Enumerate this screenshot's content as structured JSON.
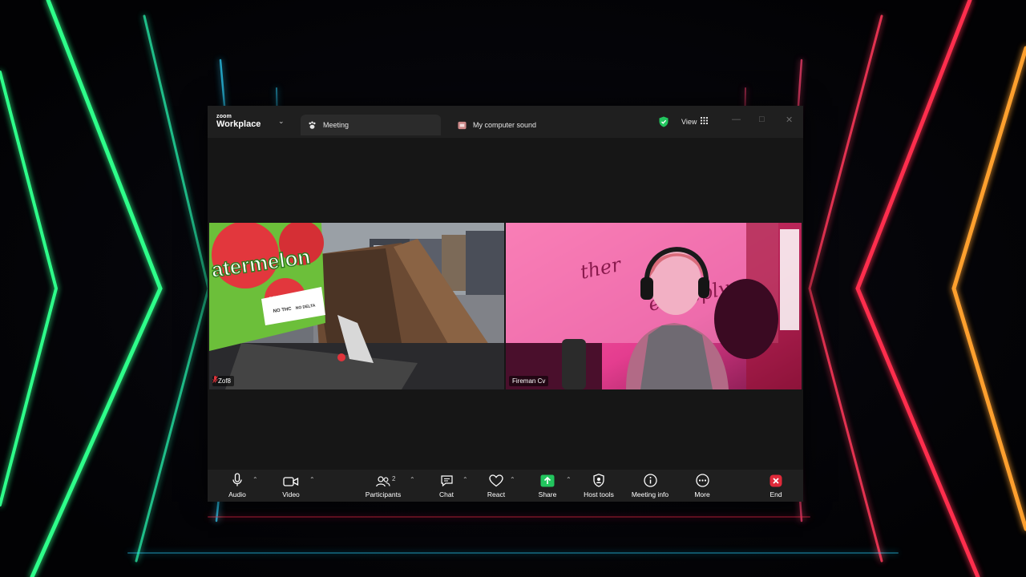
{
  "colors": {
    "neon_green": "#2dff8a",
    "neon_red": "#ff2d4d",
    "neon_orange": "#ffa02d",
    "neon_teal": "#2dd4ff",
    "zoom_dark": "#1a1a1a",
    "share_green": "#22c55e",
    "end_red": "#e02a3a"
  },
  "app": {
    "brand_small": "zoom",
    "brand_big": "Workplace"
  },
  "tabs": [
    {
      "label": "Meeting",
      "icon": "meeting-paw-icon",
      "active": true
    },
    {
      "label": "My computer sound",
      "icon": "speaker-app-icon",
      "active": false
    }
  ],
  "header": {
    "view_label": "View",
    "security_icon": "shield-check-icon"
  },
  "participants": [
    {
      "name": "Zof8",
      "muted": true
    },
    {
      "name": "Fireman Cv",
      "muted": false
    }
  ],
  "video_1": {
    "sign_text": "atermelon",
    "sub_text": "3 GUMMIES PER BAG",
    "tag1": "NO THC",
    "tag2": "NO DELTA"
  },
  "video_2": {
    "banner_text_1": "ther",
    "banner_text_2": "e deeply"
  },
  "toolbar": {
    "audio": "Audio",
    "video": "Video",
    "participants": "Participants",
    "participant_count": "2",
    "chat": "Chat",
    "react": "React",
    "share": "Share",
    "host_tools": "Host tools",
    "meeting_info": "Meeting info",
    "more": "More",
    "end": "End"
  }
}
